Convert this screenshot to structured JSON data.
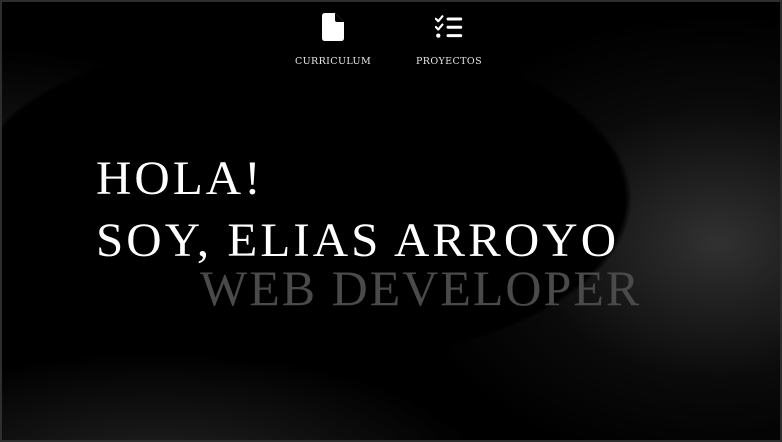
{
  "nav": {
    "items": [
      {
        "label": "CURRICULUM",
        "icon": "document-icon"
      },
      {
        "label": "PROYECTOS",
        "icon": "checklist-icon"
      }
    ]
  },
  "hero": {
    "greeting": "HOLA!",
    "intro": "SOY, ELIAS ARROYO",
    "role": "WEB DEVELOPER"
  },
  "colors": {
    "background": "#000000",
    "text": "#ffffff",
    "subtitle": "#4a4a4a"
  }
}
